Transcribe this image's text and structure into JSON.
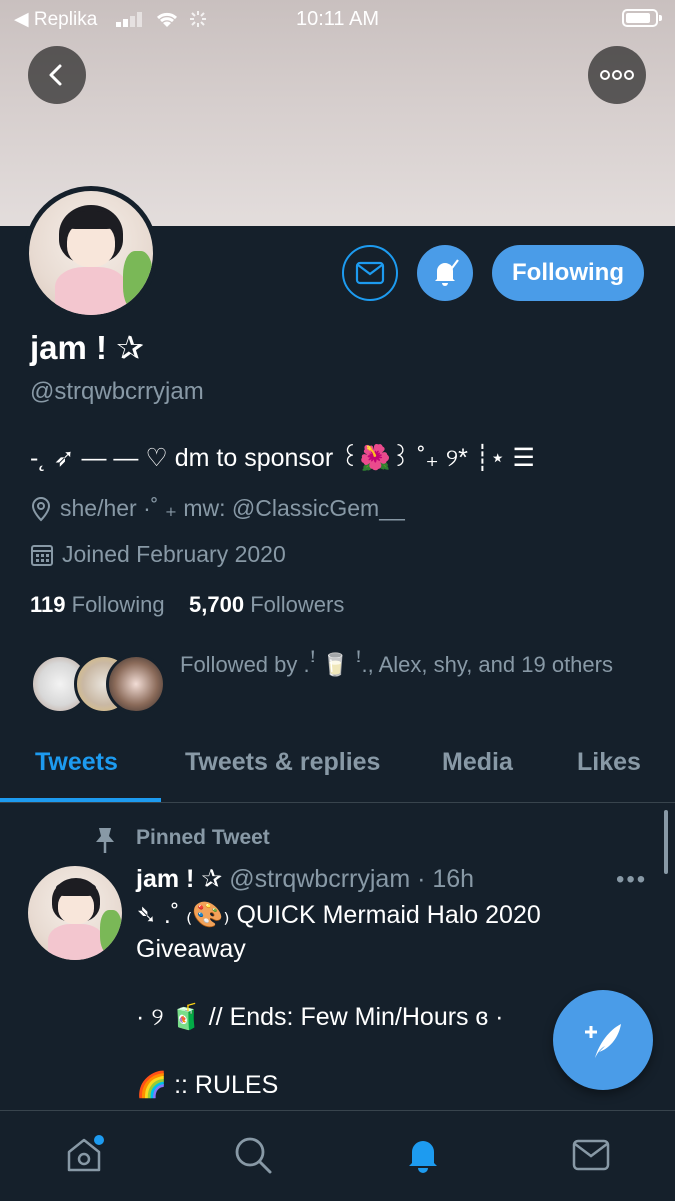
{
  "status_bar": {
    "carrier": "◀ Replika",
    "time": "10:11 AM"
  },
  "profile": {
    "name": "jam ! ✰",
    "handle": "@strqwbcrryjam",
    "bio": "-˛ ➶ — — ♡ dm to sponsor ꒰🌺꒱ ˚₊ ୨* ┊⋆ ☰",
    "location": "she/her ·˚ ₊ mw: @ClassicGem__",
    "joined": "Joined February 2020",
    "following_count": "119",
    "following_label": "Following",
    "followers_count": "5,700",
    "followers_label": "Followers",
    "followed_by": "Followed by .ꜝ 🥛 ꜝ., Alex, shy, and 19 others"
  },
  "actions": {
    "following_button": "Following"
  },
  "tabs": [
    {
      "label": "Tweets",
      "active": true
    },
    {
      "label": "Tweets & replies",
      "active": false
    },
    {
      "label": "Media",
      "active": false
    },
    {
      "label": "Likes",
      "active": false
    }
  ],
  "tweet": {
    "pinned_label": "Pinned Tweet",
    "name": "jam ! ✰",
    "handle_time": "@strqwbcrryjam · 16h",
    "line1": "➴ .˚ ₍🎨₎ QUICK Mermaid Halo 2020 Giveaway",
    "line2": "· ୨ 🧃 // Ends: Few Min/Hours ɞ ·",
    "line3": "🌈 :: RULES"
  },
  "colors": {
    "background": "#15202b",
    "accent": "#1d9bf0",
    "button_fill": "#4a9ce8",
    "secondary_text": "#8899a6"
  },
  "icons": {
    "back": "back-arrow-icon",
    "more": "more-dots-icon",
    "mail": "mail-icon",
    "bell": "bell-check-icon",
    "location": "location-pin-icon",
    "calendar": "calendar-icon",
    "pin": "pin-icon",
    "compose": "compose-feather-icon",
    "home": "home-icon",
    "search": "search-icon",
    "notifications": "notifications-bell-icon",
    "messages": "messages-mail-icon"
  }
}
